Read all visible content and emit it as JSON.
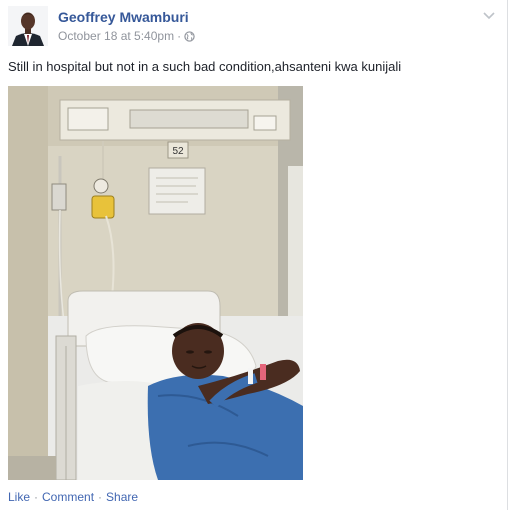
{
  "post": {
    "author": "Geoffrey Mwamburi",
    "timestamp": "October 18 at 5:40pm",
    "separator": "·",
    "privacy_icon": "globe-icon",
    "menu_icon": "chevron-down-icon",
    "text": "Still in hospital but not in a such bad condition,ahsanteni kwa kunijali",
    "photo": {
      "room_number": "52",
      "description_icon": "hospital-photo"
    },
    "actions": {
      "like": "Like",
      "comment": "Comment",
      "share": "Share",
      "sep": "·"
    }
  },
  "colors": {
    "link": "#365899",
    "meta": "#90949c",
    "action_link": "#4267b2",
    "text": "#1d2129"
  }
}
